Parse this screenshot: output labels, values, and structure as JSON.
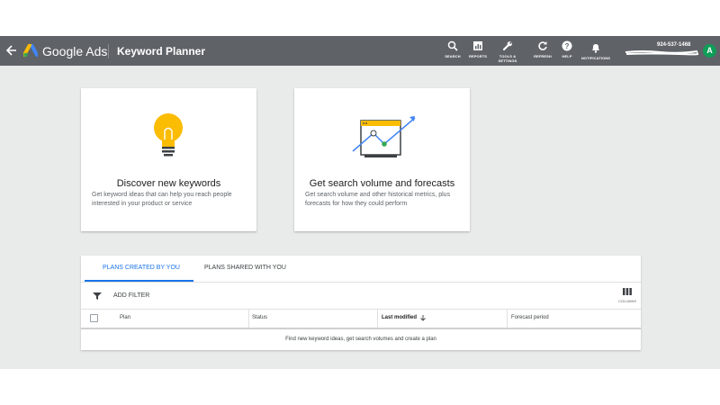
{
  "header": {
    "brand": "Google Ads",
    "page_title": "Keyword Planner",
    "back_icon": "arrow-back-icon",
    "logo_icon": "google-ads-logo-icon",
    "tools": [
      {
        "label": "SEARCH",
        "icon": "search-icon"
      },
      {
        "label": "REPORTS",
        "icon": "reports-icon"
      },
      {
        "label": "TOOLS &\nSETTINGS",
        "icon": "wrench-icon"
      },
      {
        "label": "REFRESH",
        "icon": "refresh-icon"
      },
      {
        "label": "HELP",
        "icon": "help-icon"
      },
      {
        "label": "NOTIFICATIONS",
        "icon": "bell-icon"
      }
    ],
    "account_number": "924-537-1468",
    "avatar_letter": "A"
  },
  "cards": [
    {
      "title": "Discover new keywords",
      "description": "Get keyword ideas that can help you reach people interested in your product or service",
      "icon": "lightbulb-icon"
    },
    {
      "title": "Get search volume and forecasts",
      "description": "Get search volume and other historical metrics, plus forecasts for how they could perform",
      "icon": "forecast-chart-icon"
    }
  ],
  "plans": {
    "tabs": [
      {
        "label": "PLANS CREATED BY YOU",
        "active": true
      },
      {
        "label": "PLANS SHARED WITH YOU",
        "active": false
      }
    ],
    "add_filter": "ADD FILTER",
    "columns_label": "COLUMNS",
    "table_headers": [
      "Plan",
      "Status",
      "Last modified",
      "Forecast period"
    ],
    "sort_icon": "arrow-down-icon",
    "empty_message": "Find new keyword ideas, get search volumes and create a plan"
  },
  "colors": {
    "topbar": "#5f6368",
    "background": "#e9eaea",
    "accent_blue": "#1a73e8",
    "avatar_green": "#0f9d58",
    "bulb_yellow": "#fbbc04"
  }
}
